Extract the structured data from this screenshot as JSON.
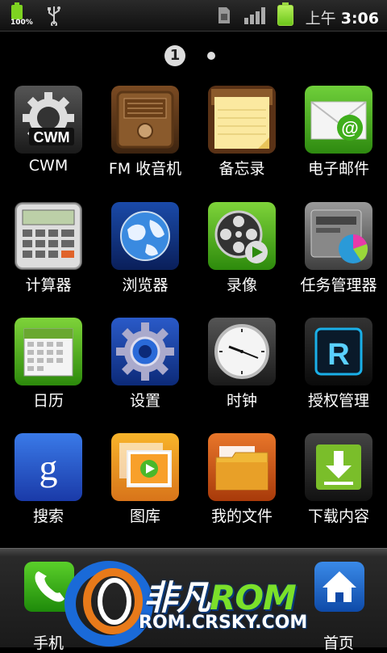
{
  "status_bar": {
    "battery_small_percent": "100%",
    "time_prefix": "上午",
    "time": "3:06",
    "icons": [
      "battery-small-icon",
      "usb-icon",
      "sim-icon",
      "signal-icon",
      "battery-icon"
    ]
  },
  "pager": {
    "current_page": "1",
    "pages": 2
  },
  "apps": [
    {
      "label": "CWM",
      "icon": "gear-icon"
    },
    {
      "label": "FM 收音机",
      "icon": "radio-icon"
    },
    {
      "label": "备忘录",
      "icon": "notepad-icon"
    },
    {
      "label": "电子邮件",
      "icon": "email-icon"
    },
    {
      "label": "计算器",
      "icon": "calculator-icon"
    },
    {
      "label": "浏览器",
      "icon": "globe-icon"
    },
    {
      "label": "录像",
      "icon": "film-reel-icon"
    },
    {
      "label": "任务管理器",
      "icon": "task-manager-icon"
    },
    {
      "label": "日历",
      "icon": "calendar-icon"
    },
    {
      "label": "设置",
      "icon": "settings-gear-icon"
    },
    {
      "label": "时钟",
      "icon": "clock-icon"
    },
    {
      "label": "授权管理",
      "icon": "superuser-icon"
    },
    {
      "label": "搜索",
      "icon": "google-search-icon"
    },
    {
      "label": "图库",
      "icon": "gallery-icon"
    },
    {
      "label": "我的文件",
      "icon": "folder-icon"
    },
    {
      "label": "下载内容",
      "icon": "download-icon"
    }
  ],
  "dock": {
    "phone_label": "手机",
    "home_label": "首页"
  },
  "watermark": {
    "line1_a": "非凡",
    "line1_b": "ROM",
    "line2": "ROM.CRSKY.COM"
  }
}
